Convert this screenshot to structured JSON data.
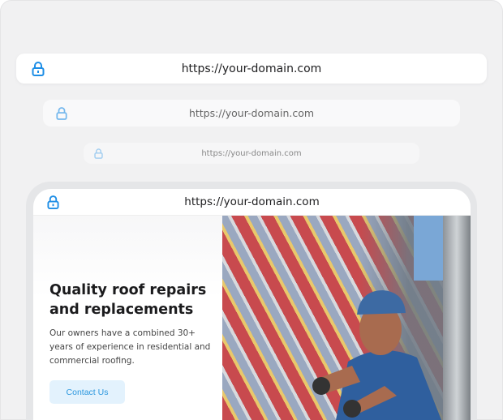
{
  "address_bars": [
    {
      "url": "https://your-domain.com",
      "icon": "lock-icon"
    },
    {
      "url": "https://your-domain.com",
      "icon": "lock-icon"
    },
    {
      "url": "https://your-domain.com",
      "icon": "lock-icon"
    }
  ],
  "device": {
    "url": "https://your-domain.com",
    "hero": {
      "title": "Quality roof repairs and replacements",
      "description": "Our owners have a combined 30+ years of experience in residential and commercial roofing.",
      "cta_label": "Contact Us"
    },
    "image": "roofer-working-on-metal-roof"
  },
  "colors": {
    "accent": "#2b97de",
    "button_bg": "#e3f2fd",
    "lock": "#1e8ee6"
  }
}
